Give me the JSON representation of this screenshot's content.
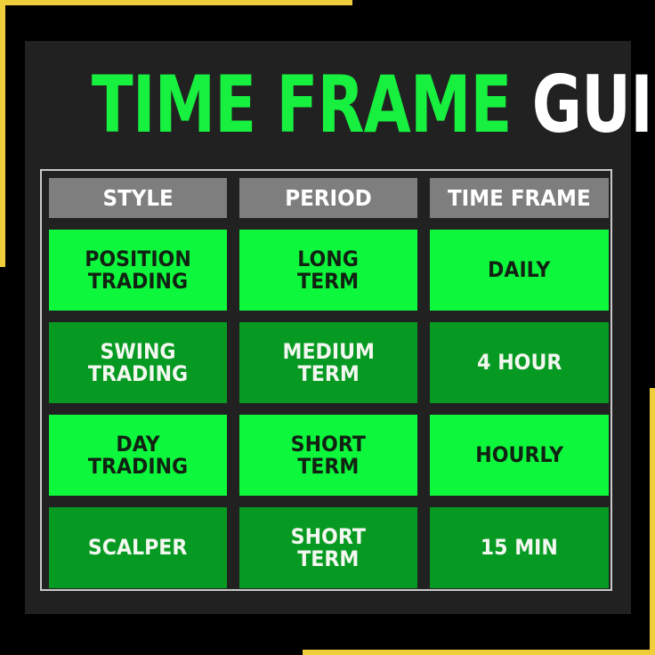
{
  "title": {
    "part1": "TIME FRAME",
    "part2": "GUIDE"
  },
  "colors": {
    "background": "#000000",
    "accent_border": "#f0cd3a",
    "panel": "#212121",
    "title_green": "#17f03f",
    "title_white": "#ffffff",
    "header_cell": "#7e7e7e",
    "row_bright_green": "#0df83c",
    "row_dark_green": "#069a22"
  },
  "table": {
    "headers": [
      "STYLE",
      "PERIOD",
      "TIME FRAME"
    ],
    "rows": [
      {
        "style": [
          "POSITION",
          "TRADING"
        ],
        "period": [
          "LONG",
          "TERM"
        ],
        "time_frame": [
          "DAILY"
        ],
        "shade": "bright"
      },
      {
        "style": [
          "SWING",
          "TRADING"
        ],
        "period": [
          "MEDIUM",
          "TERM"
        ],
        "time_frame": [
          "4 HOUR"
        ],
        "shade": "dark"
      },
      {
        "style": [
          "DAY",
          "TRADING"
        ],
        "period": [
          "SHORT",
          "TERM"
        ],
        "time_frame": [
          "HOURLY"
        ],
        "shade": "bright"
      },
      {
        "style": [
          "SCALPER"
        ],
        "period": [
          "SHORT",
          "TERM"
        ],
        "time_frame": [
          "15 MIN"
        ],
        "shade": "dark"
      }
    ]
  }
}
